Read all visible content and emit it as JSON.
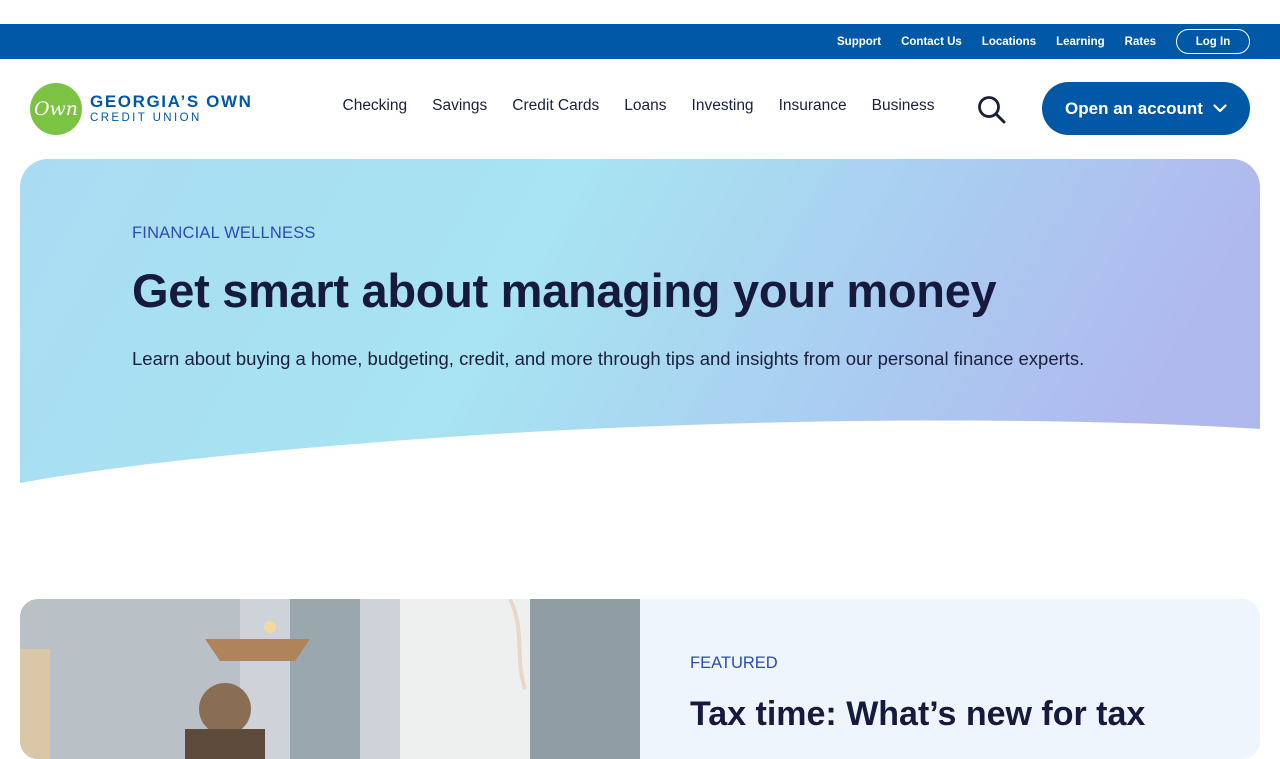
{
  "utility_nav": {
    "links": [
      "Support",
      "Contact Us",
      "Locations",
      "Learning",
      "Rates"
    ],
    "login_label": "Log In"
  },
  "brand": {
    "logo_mark": "Own",
    "name": "GEORGIA’S OWN",
    "subname": "CREDIT UNION"
  },
  "main_nav": {
    "items": [
      "Checking",
      "Savings",
      "Credit Cards",
      "Loans",
      "Investing",
      "Insurance",
      "Business"
    ],
    "search_icon": "search-icon",
    "open_account_label": "Open an account"
  },
  "hero": {
    "eyebrow": "FINANCIAL WELLNESS",
    "title": "Get smart about managing your money",
    "description": "Learn about buying a home, budgeting, credit, and more through tips and insights from our personal finance experts."
  },
  "featured": {
    "eyebrow": "FEATURED",
    "title": "Tax time: What’s new for tax"
  },
  "colors": {
    "primary": "#0058a6",
    "logo_green": "#7cc243",
    "heading": "#161a3d",
    "eyebrow": "#2a4cb3"
  }
}
